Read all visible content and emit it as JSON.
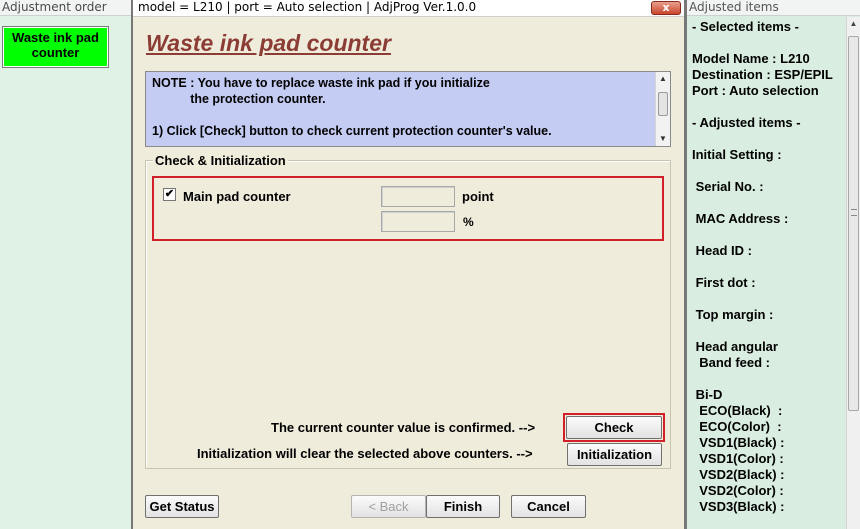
{
  "left_panel": {
    "title": "Adjustment order",
    "items": [
      {
        "label": "Waste ink pad\ncounter",
        "state": "current",
        "color": "#00ff00"
      }
    ]
  },
  "window": {
    "title": "model = L210 | port = Auto selection | AdjProg Ver.1.0.0",
    "close_glyph": "x",
    "heading": "Waste ink pad counter",
    "note": "NOTE : You have to replace waste ink pad if you initialize\n           the protection counter.\n\n1) Click [Check] button to check current protection counter's value.",
    "note_scroll_up": "▲",
    "note_scroll_down": "▼",
    "group": {
      "label": "Check & Initialization",
      "counter": {
        "checked": true,
        "check_glyph": "✔",
        "label": "Main pad counter",
        "point_value": "",
        "percent_value": "",
        "point_unit": "point",
        "percent_unit": "%"
      },
      "confirm_text": "The current counter value is confirmed. -->",
      "init_text": "Initialization will clear the selected above counters. -->",
      "check_button": "Check",
      "init_button": "Initialization"
    },
    "buttons": {
      "get_status": "Get Status",
      "back": "< Back",
      "finish": "Finish",
      "cancel": "Cancel"
    }
  },
  "right_panel": {
    "title": "Adjusted items",
    "text": "- Selected items -\n\nModel Name : L210\nDestination : ESP/EPIL\nPort : Auto selection\n\n- Adjusted items -\n\nInitial Setting :\n\n Serial No. :\n\n MAC Address :\n\n Head ID :\n\n First dot :\n\n Top margin :\n\n Head angular\n  Band feed :\n\n Bi-D\n  ECO(Black)  :\n  ECO(Color)  :\n  VSD1(Black) :\n  VSD1(Color) :\n  VSD2(Black) :\n  VSD2(Color) :\n  VSD3(Black) :",
    "scroll_up": "▲"
  },
  "colors": {
    "accent_highlight": "#d21f2a",
    "heading": "#8b3d35",
    "note_bg": "#c4ccf4",
    "window_bg": "#f0ecdc",
    "panel_bg": "#dff2e5"
  }
}
